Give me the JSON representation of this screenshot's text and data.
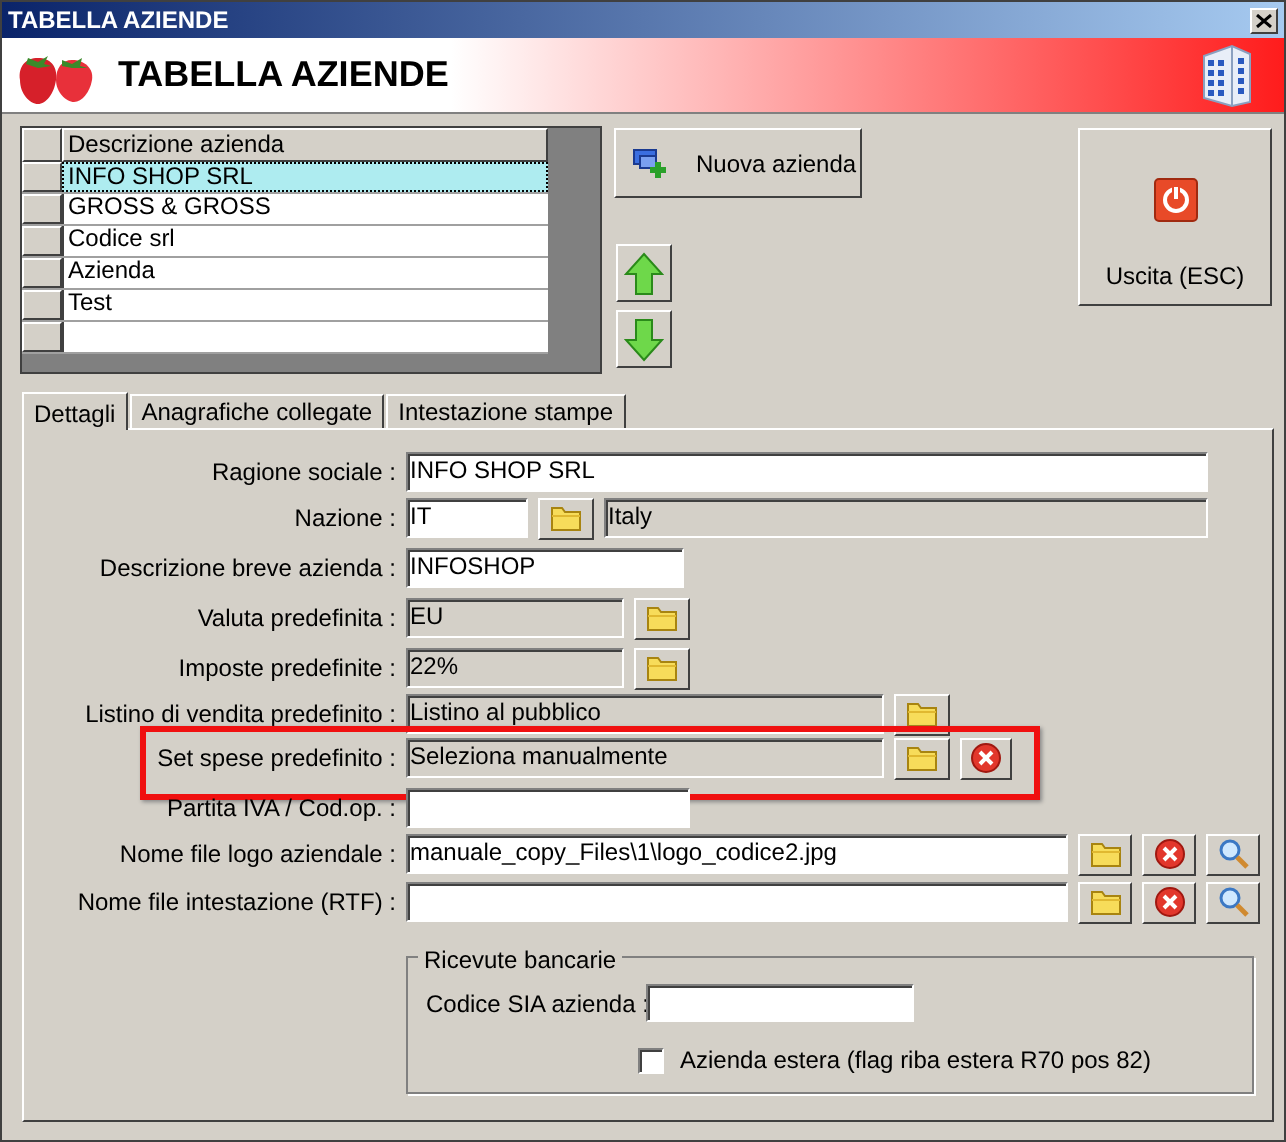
{
  "window": {
    "title": "TABELLA AZIENDE"
  },
  "header": {
    "title": "TABELLA AZIENDE"
  },
  "company_grid": {
    "columns": [
      "Descrizione azienda"
    ],
    "rows": [
      {
        "name": "INFO SHOP SRL",
        "selected": true
      },
      {
        "name": "GROSS & GROSS",
        "selected": false
      },
      {
        "name": "Codice srl",
        "selected": false
      },
      {
        "name": "Azienda",
        "selected": false
      },
      {
        "name": "Test",
        "selected": false
      }
    ]
  },
  "new_company_button": {
    "label": "Nuova azienda"
  },
  "exit_button": {
    "label": "Uscita (ESC)"
  },
  "tabs": [
    {
      "label": "Dettagli",
      "selected": true
    },
    {
      "label": "Anagrafiche collegate",
      "selected": false
    },
    {
      "label": "Intestazione stampe",
      "selected": false
    }
  ],
  "fields": [
    {
      "label": "Ragione sociale :",
      "highlighted": false,
      "parts": [
        {
          "kind": "input",
          "value": "INFO SHOP SRL"
        }
      ]
    },
    {
      "label": "Nazione :",
      "highlighted": false,
      "parts": [
        {
          "kind": "input",
          "value": "IT"
        },
        {
          "kind": "browse"
        },
        {
          "kind": "readonly",
          "value": "Italy"
        }
      ]
    },
    {
      "label": "Descrizione breve azienda :",
      "highlighted": false,
      "parts": [
        {
          "kind": "input",
          "value": "INFOSHOP"
        }
      ]
    },
    {
      "label": "Valuta predefinita :",
      "highlighted": false,
      "parts": [
        {
          "kind": "readonly",
          "value": "EU"
        },
        {
          "kind": "browse"
        }
      ]
    },
    {
      "label": "Imposte predefinite :",
      "highlighted": false,
      "parts": [
        {
          "kind": "readonly",
          "value": "22%"
        },
        {
          "kind": "browse"
        }
      ]
    },
    {
      "label": "Listino di vendita predefinito :",
      "highlighted": false,
      "parts": [
        {
          "kind": "readonly",
          "value": "Listino al pubblico"
        },
        {
          "kind": "browse"
        }
      ]
    },
    {
      "label": "Set spese predefinito :",
      "highlighted": true,
      "parts": [
        {
          "kind": "readonly",
          "value": "Seleziona manualmente"
        },
        {
          "kind": "browse"
        },
        {
          "kind": "clear"
        }
      ]
    },
    {
      "label": "Partita IVA / Cod.op. :",
      "highlighted": false,
      "parts": [
        {
          "kind": "input"
        }
      ]
    },
    {
      "label": "Nome file logo aziendale :",
      "highlighted": false,
      "parts": [
        {
          "kind": "input",
          "value": "manuale_copy_Files\\1\\logo_codice2.jpg"
        },
        {
          "kind": "browse"
        },
        {
          "kind": "clear"
        },
        {
          "kind": "preview"
        }
      ]
    },
    {
      "label": "Nome file intestazione (RTF) :",
      "highlighted": false,
      "parts": [
        {
          "kind": "input"
        },
        {
          "kind": "browse"
        },
        {
          "kind": "clear"
        },
        {
          "kind": "preview"
        }
      ]
    }
  ],
  "bank_receipts": {
    "title": "Ricevute bancarie",
    "sia_label": "Codice SIA azienda :",
    "foreign_checkbox": {
      "label": "Azienda estera (flag riba estera R70 pos 82)",
      "checked": false
    }
  }
}
